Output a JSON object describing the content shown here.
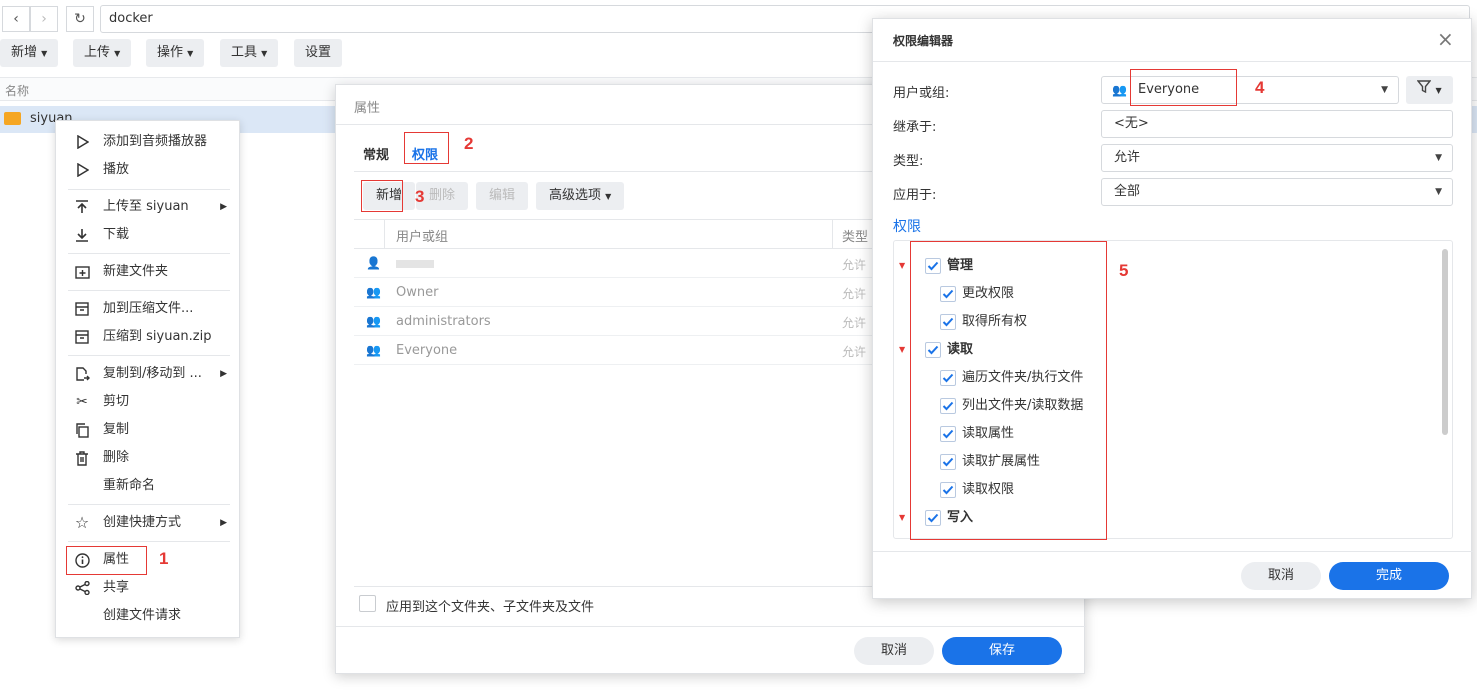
{
  "browser": {
    "back_label": "‹",
    "forward_label": "›",
    "refresh_label": "↻",
    "path": "docker"
  },
  "toolbar": {
    "create": "新增",
    "upload": "上传",
    "action": "操作",
    "tools": "工具",
    "settings": "设置"
  },
  "list": {
    "name_header": "名称",
    "item_name": "siyuan"
  },
  "context_menu": {
    "items": [
      {
        "label": "添加到音频播放器",
        "icon": "play-outline-icon"
      },
      {
        "label": "播放",
        "icon": "play-outline-icon"
      },
      {
        "label": "上传至 siyuan",
        "icon": "upload-icon"
      },
      {
        "label": "下载",
        "icon": "download-icon"
      },
      {
        "label": "新建文件夹",
        "icon": "new-folder-icon"
      },
      {
        "label": "加到压缩文件...",
        "icon": "archive-icon"
      },
      {
        "label": "压缩到 siyuan.zip",
        "icon": "archive-icon"
      },
      {
        "label": "复制到/移动到 ...",
        "icon": "copy-move-icon"
      },
      {
        "label": "剪切",
        "icon": "scissors-icon"
      },
      {
        "label": "复制",
        "icon": "copy-icon"
      },
      {
        "label": "删除",
        "icon": "trash-icon"
      },
      {
        "label": "重新命名",
        "icon": ""
      },
      {
        "label": "创建快捷方式",
        "icon": "star-icon"
      },
      {
        "label": "属性",
        "icon": "info-icon"
      },
      {
        "label": "共享",
        "icon": "share-icon"
      },
      {
        "label": "创建文件请求",
        "icon": ""
      }
    ]
  },
  "properties_dialog": {
    "title": "属性",
    "tab_general": "常规",
    "tab_permission": "权限",
    "btn_create": "新增",
    "btn_delete": "删除",
    "btn_edit": "编辑",
    "btn_advanced": "高级选项",
    "col_user_group": "用户或组",
    "col_type": "类型",
    "rows": [
      {
        "name": "",
        "type": "允许"
      },
      {
        "name": "Owner",
        "type": "允许"
      },
      {
        "name": "administrators",
        "type": "允许"
      },
      {
        "name": "Everyone",
        "type": "允许"
      }
    ],
    "apply_checkbox_label": "应用到这个文件夹、子文件夹及文件",
    "cancel": "取消",
    "save": "保存"
  },
  "permission_editor": {
    "title": "权限编辑器",
    "close": "×",
    "label_user_group": "用户或组:",
    "value_user_group": "Everyone",
    "label_inherit": "继承于:",
    "value_inherit": "<无>",
    "label_type": "类型:",
    "value_type": "允许",
    "label_apply": "应用于:",
    "value_apply": "全部",
    "section_permission": "权限",
    "permissions": {
      "admin": "管理",
      "change_perm": "更改权限",
      "take_owner": "取得所有权",
      "read": "读取",
      "traverse": "遍历文件夹/执行文件",
      "list": "列出文件夹/读取数据",
      "read_attr": "读取属性",
      "read_ext_attr": "读取扩展属性",
      "read_perm": "读取权限",
      "write": "写入"
    },
    "cancel": "取消",
    "done": "完成"
  },
  "annotations": {
    "n1": "1",
    "n2": "2",
    "n3": "3",
    "n4": "4",
    "n5": "5"
  },
  "colors": {
    "accent": "#1a73e8",
    "annotation": "#e53935",
    "folder": "#f5a623"
  }
}
